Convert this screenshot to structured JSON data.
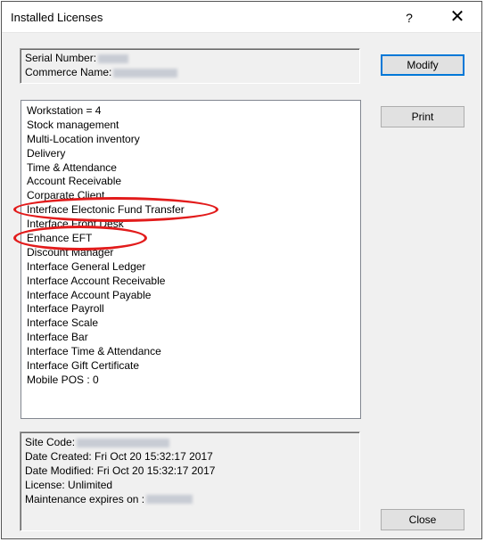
{
  "window": {
    "title": "Installed Licenses",
    "help_glyph": "?",
    "close_glyph": "✕"
  },
  "header_info": {
    "serial_label": "Serial Number:",
    "commerce_label": "Commerce Name:"
  },
  "licenses": [
    "Workstation = 4",
    "Stock management",
    "Multi-Location inventory",
    "Delivery",
    "Time & Attendance",
    "Account Receivable",
    "Corparate Client",
    "Interface Electonic Fund Transfer",
    "Interface Front Desk",
    "Enhance EFT",
    "Discount Manager",
    "Interface General Ledger",
    "Interface Account Receivable",
    "Interface Account Payable",
    "Interface Payroll",
    "Interface Scale",
    "Interface Bar",
    "Interface Time & Attendance",
    "Interface Gift Certificate",
    "Mobile POS : 0"
  ],
  "footer_info": {
    "site_code_label": "Site Code:",
    "date_created": "Date Created: Fri Oct 20 15:32:17 2017",
    "date_modified": "Date Modified: Fri Oct 20 15:32:17 2017",
    "license": "License: Unlimited",
    "maintenance_label": "Maintenance expires on :"
  },
  "buttons": {
    "modify": "Modify",
    "print": "Print",
    "close": "Close"
  },
  "colors": {
    "highlight_ellipse": "#e21b1b",
    "dialog_bg": "#f0f0f0"
  }
}
